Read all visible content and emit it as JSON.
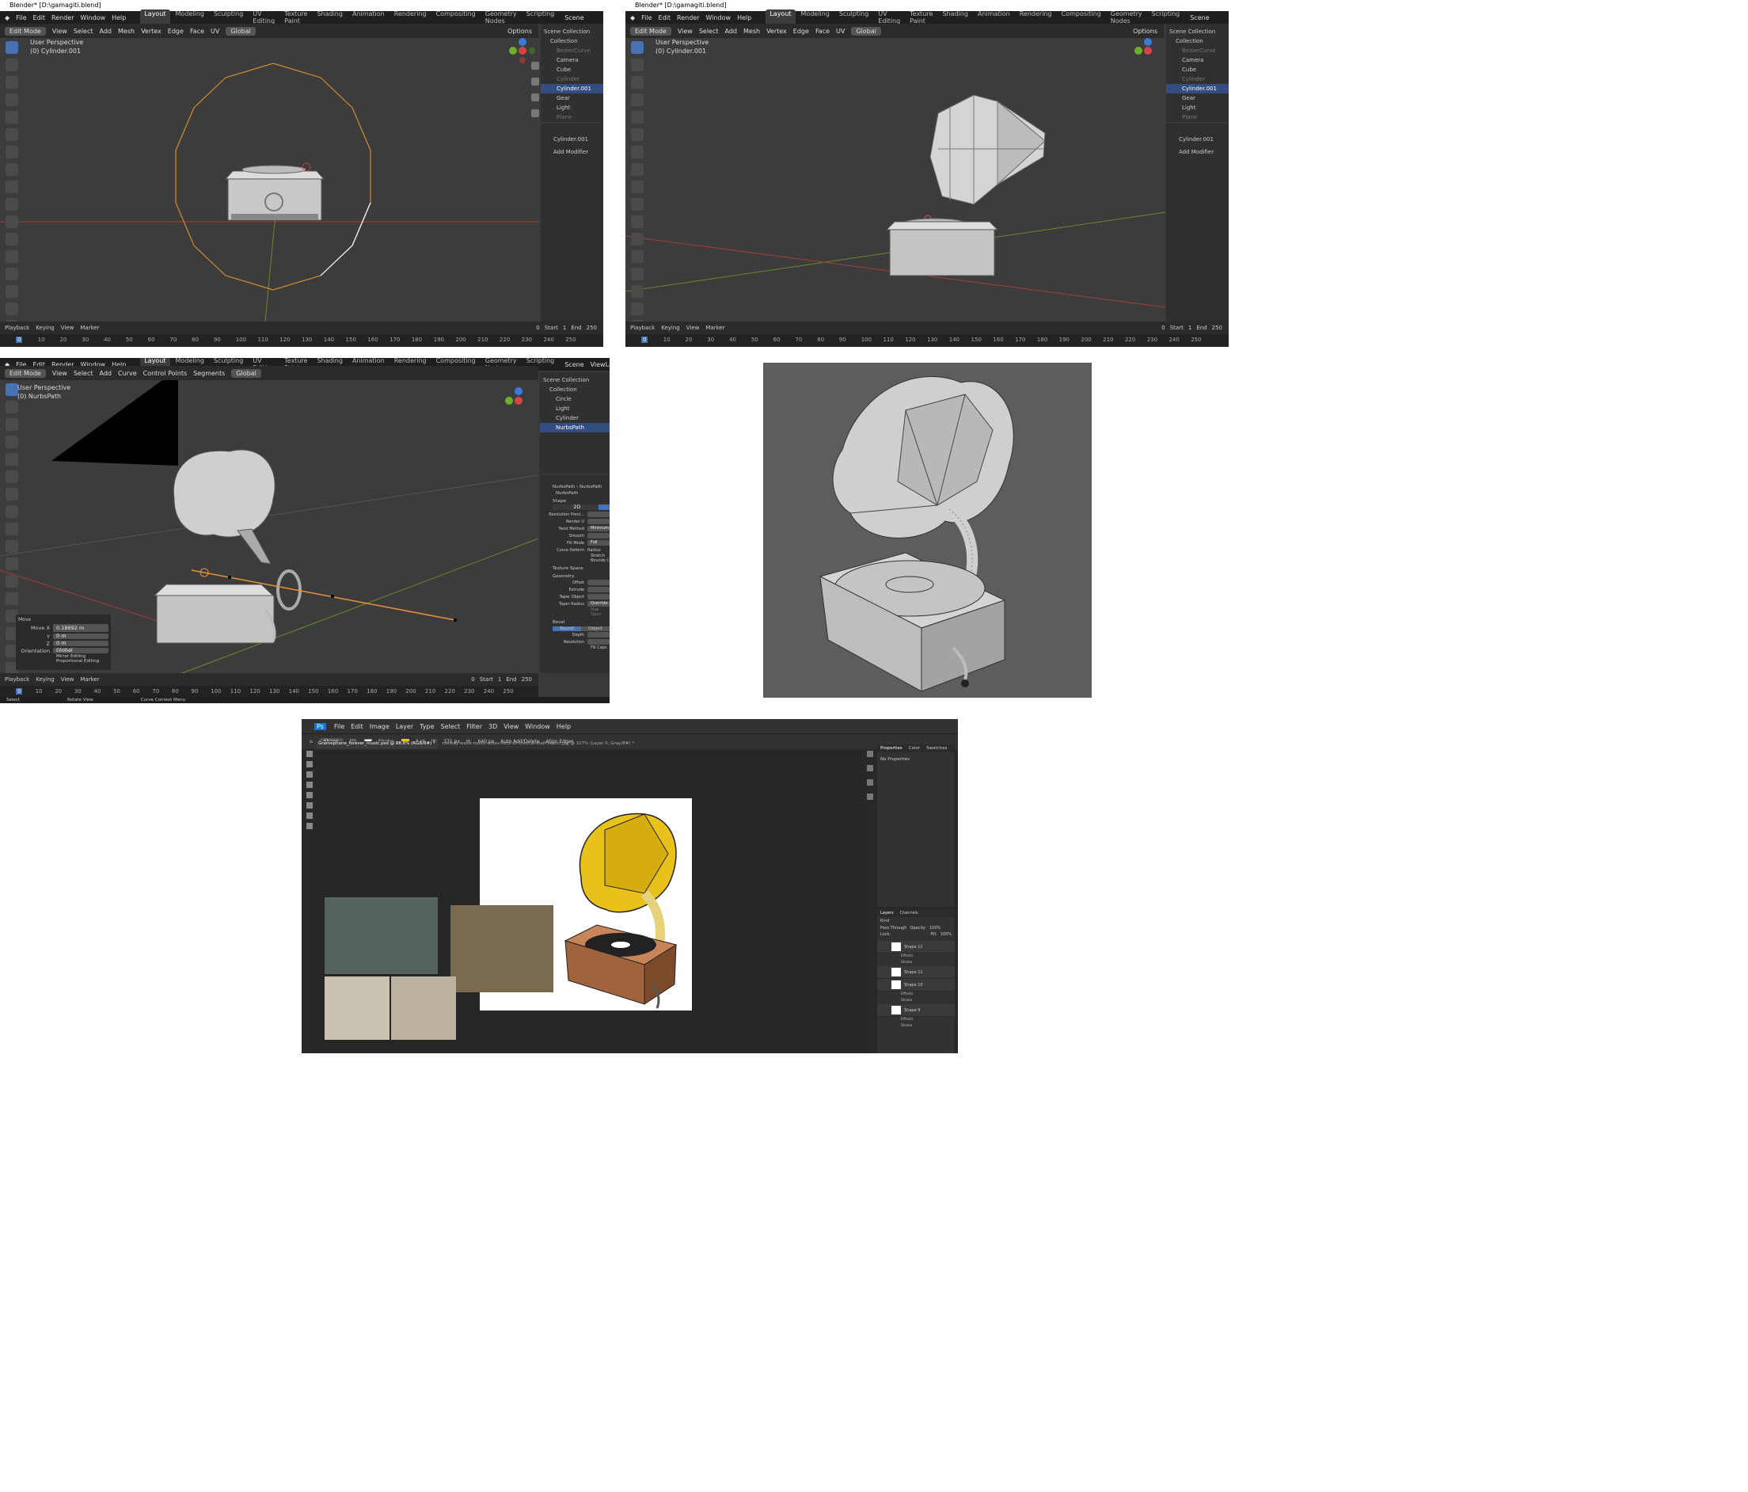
{
  "blender_title_1": "Blender* [D:\\gamagiti.blend]",
  "blender_title_2": "Blender* [D:\\gamagiti.blend]",
  "menus": [
    "File",
    "Edit",
    "Render",
    "Window",
    "Help"
  ],
  "workspaces": [
    "Layout",
    "Modeling",
    "Sculpting",
    "UV Editing",
    "Texture Paint",
    "Shading",
    "Animation",
    "Rendering",
    "Compositing",
    "Geometry Nodes",
    "Scripting"
  ],
  "editmode": "Edit Mode",
  "mesh_menu": [
    "View",
    "Select",
    "Add",
    "Mesh",
    "Vertex",
    "Edge",
    "Face",
    "UV"
  ],
  "curve_menu": [
    "View",
    "Select",
    "Add",
    "Curve",
    "Control Points",
    "Segments"
  ],
  "orientation": "Global",
  "options": "Options",
  "scene": "Scene",
  "viewlayer": "ViewLayer",
  "persp": "User Perspective",
  "sel_cyl": "(0) Cylinder.001",
  "sel_nurbs": "(0) NurbsPath",
  "outliner1": [
    {
      "name": "Scene Collection",
      "cls": ""
    },
    {
      "name": "Collection",
      "cls": ""
    },
    {
      "name": "BezierCurve",
      "cls": "dim"
    },
    {
      "name": "Camera",
      "cls": ""
    },
    {
      "name": "Cube",
      "cls": ""
    },
    {
      "name": "Cylinder",
      "cls": "dim"
    },
    {
      "name": "Cylinder.001",
      "cls": "sel"
    },
    {
      "name": "Gear",
      "cls": ""
    },
    {
      "name": "Light",
      "cls": ""
    },
    {
      "name": "Plane",
      "cls": "dim"
    }
  ],
  "outliner3": [
    {
      "name": "Scene Collection",
      "cls": ""
    },
    {
      "name": "Collection",
      "cls": ""
    },
    {
      "name": "Circle",
      "cls": ""
    },
    {
      "name": "Light",
      "cls": ""
    },
    {
      "name": "Cylinder",
      "cls": ""
    },
    {
      "name": "NurbsPath",
      "cls": "sel"
    }
  ],
  "props_obj": "Cylinder.001",
  "add_modifier": "Add Modifier",
  "timeline": {
    "playback": "Playback",
    "keying": "Keying",
    "view": "View",
    "marker": "Marker",
    "frame": "0",
    "start_label": "Start",
    "start": "1",
    "end_label": "End",
    "end": "250"
  },
  "ruler": [
    "0",
    "10",
    "20",
    "30",
    "40",
    "50",
    "60",
    "70",
    "80",
    "90",
    "100",
    "110",
    "120",
    "130",
    "140",
    "150",
    "160",
    "170",
    "180",
    "190",
    "200",
    "210",
    "220",
    "230",
    "240",
    "250"
  ],
  "nurbs_panel": {
    "breadcrumb_a": "NurbsPath",
    "breadcrumb_b": "NurbsPath",
    "data": "NurbsPath",
    "shape": "Shape",
    "dim2d": "2D",
    "res_preview": "Resolution Previ...",
    "render_u": "Render U",
    "twist_method": "Twist Method",
    "twist_val": "Minimum",
    "smooth": "Smooth",
    "fill_mode": "Fill Mode",
    "fill_val": "Full",
    "curve_deform": "Curve Deform",
    "radius": "Radius",
    "stretch": "Stretch",
    "bounds": "Bounds C",
    "texture_space": "Texture Space",
    "geometry": "Geometry",
    "offset": "Offset",
    "extrude": "Extrude",
    "taper_object": "Taper Object",
    "taper_radius": "Taper Radius",
    "taper_val": "Override",
    "map_taper": "Map Taper",
    "bevel": "Bevel",
    "round": "Round",
    "object": "Object",
    "depth": "Depth",
    "resolution": "Resolution",
    "fill_caps": "Fill Caps"
  },
  "move_panel": {
    "title": "Move",
    "movex_label": "Move X",
    "movex": "0.18692 m",
    "y_label": "Y",
    "y": "0 m",
    "z_label": "Z",
    "z": "0 m",
    "orient_label": "Orientation",
    "orient": "Global",
    "mirror": "Mirror Editing",
    "proportional": "Proportional Editing"
  },
  "status3": {
    "select": "Select",
    "rotate": "Rotate View",
    "curve_ctx": "Curve Context Menu"
  },
  "ps": {
    "menus": [
      "File",
      "Edit",
      "Image",
      "Layer",
      "Type",
      "Select",
      "Filter",
      "3D",
      "View",
      "Window",
      "Help"
    ],
    "shape": "Shape",
    "fill": "Fill:",
    "stroke": "Stroke:",
    "stroke_w": "3 pt",
    "w_label": "W:",
    "w": "371 px",
    "h_label": "H:",
    "h": "640 px",
    "auto_add": "Auto Add/Delete",
    "align": "Align Edges",
    "tab1": "Gramophone_forever_music.psd @ 88.8% (RGB/8#) *",
    "tab2": "melody-wave-music-notes-vent-of-musical-staff-vector.jpg @ 107% (Layer 0, Gray/8#) *",
    "props_tab": "Properties",
    "color_tab": "Color",
    "swatches_tab": "Swatches",
    "no_props": "No Properties",
    "layers_tab": "Layers",
    "channels_tab": "Channels",
    "kind": "Kind",
    "blend": "Pass Through",
    "opacity_label": "Opacity:",
    "opacity": "100%",
    "lock_label": "Lock:",
    "fill_label": "Fill:",
    "fill_val": "100%",
    "layers": [
      {
        "name": "Shape 12",
        "fx": true
      },
      {
        "name": "Effects",
        "sub": true
      },
      {
        "name": "Stroke",
        "sub": true
      },
      {
        "name": "Shape 11",
        "fx": false
      },
      {
        "name": "Shape 10",
        "fx": true
      },
      {
        "name": "Effects",
        "sub": true
      },
      {
        "name": "Stroke",
        "sub": true
      },
      {
        "name": "Shape 9",
        "fx": true
      },
      {
        "name": "Effects",
        "sub": true
      },
      {
        "name": "Stroke",
        "sub": true
      }
    ]
  },
  "colors": {
    "accent": "#4772b3",
    "orange": "#e8913a",
    "yellow": "#e8c21a",
    "brown": "#a0643c"
  }
}
